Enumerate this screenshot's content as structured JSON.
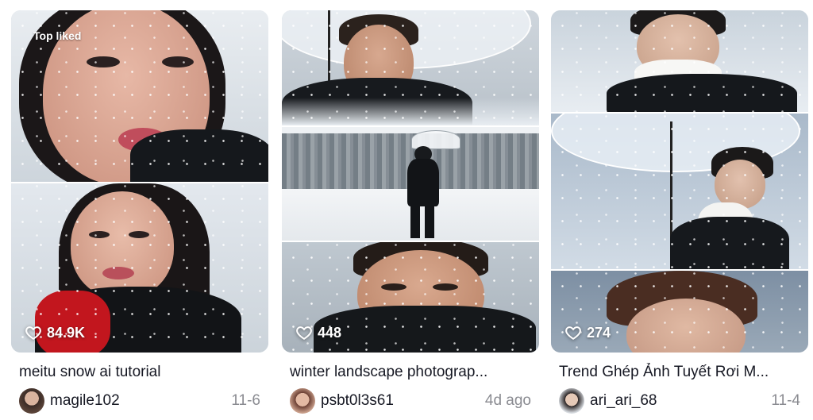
{
  "cards": [
    {
      "badge": "Top liked",
      "likes": "84.9K",
      "title": "meitu snow ai tutorial",
      "username": "magile102",
      "date": "11-6"
    },
    {
      "badge": "",
      "likes": "448",
      "title": "winter landscape photograp...",
      "username": "psbt0l3s61",
      "date": "4d ago"
    },
    {
      "badge": "",
      "likes": "274",
      "title": "Trend Ghép Ảnh Tuyết Rơi M...",
      "username": "ari_ari_68",
      "date": "11-4"
    }
  ],
  "icons": {
    "likes": "heart-outline-icon"
  },
  "colors": {
    "text": "#161823",
    "muted": "#8a8b91",
    "snow_bg": "#dfe6ee"
  }
}
